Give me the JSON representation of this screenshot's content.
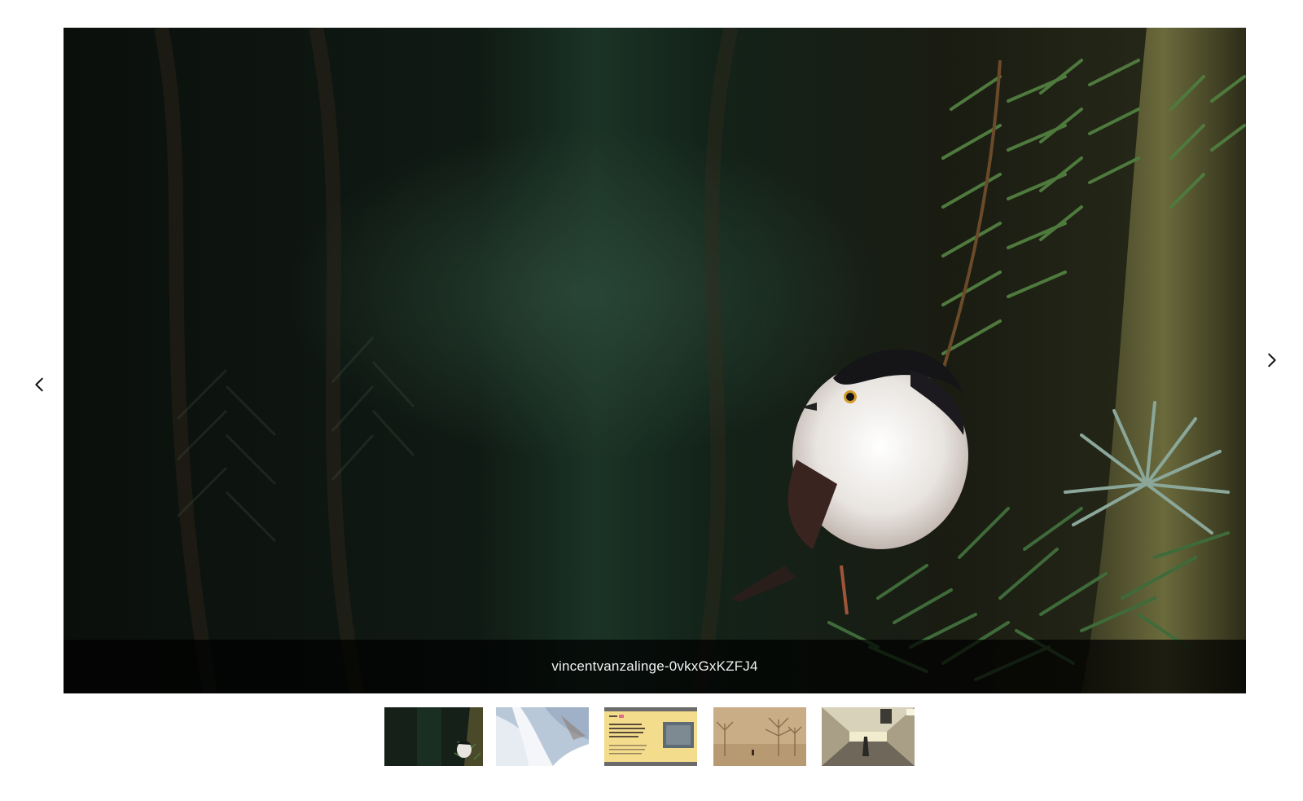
{
  "viewer": {
    "caption": "vincentvanzalinge-0vkxGxKZFJ4",
    "prev_icon": "chevron-left-icon",
    "next_icon": "chevron-right-icon"
  },
  "thumbnails": [
    {
      "subject": "bird",
      "active": true
    },
    {
      "subject": "waterfall",
      "active": false
    },
    {
      "subject": "slide",
      "active": false
    },
    {
      "subject": "foggy-trees",
      "active": false
    },
    {
      "subject": "tunnel",
      "active": false
    }
  ],
  "colors": {
    "caption_bar": "#000000b8",
    "caption_text": "#f2f2f2",
    "arrow": "#111111"
  }
}
